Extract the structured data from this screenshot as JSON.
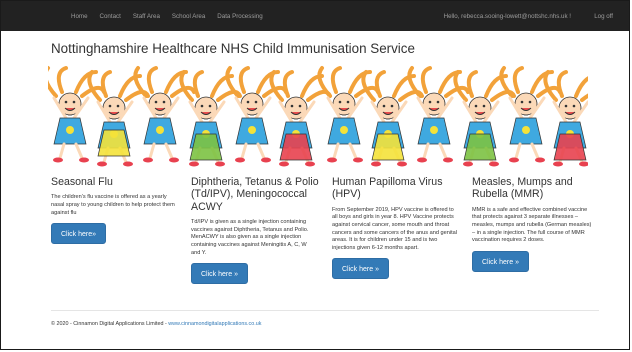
{
  "nav": {
    "items": [
      "Home",
      "Contact",
      "Staff Area",
      "School Area",
      "Data Processing"
    ],
    "user_greeting": "Hello, rebecca.sooing-lowett@nottshc.nhs.uk !",
    "logoff": "Log off"
  },
  "page": {
    "title": "Nottinghamshire Healthcare NHS Child Immunisation Service"
  },
  "columns": [
    {
      "heading": "Seasonal Flu",
      "body": "The children's flu vaccine is offered as a yearly nasal spray to young children to help protect them against flu",
      "button": "Click here»"
    },
    {
      "heading": "Diphtheria, Tetanus & Polio (Td/IPV), Meningococcal ACWY",
      "body": "Td/IPV is given as a single injection containing vaccines against Diphtheria, Tetanus and Polio. MenACWY is also given as a single injection containing vaccines against Meningitis A, C, W and Y.",
      "button": "Click here »"
    },
    {
      "heading": "Human Papilloma Virus (HPV)",
      "body": "From September 2019, HPV vaccine is offered to all boys and girls in year 8. HPV Vaccine protects against cervical cancer, some mouth and throat cancers and some cancers of the anus and genital areas. It is for children under 15 and is two injections given 6-12 months apart.",
      "button": "Click here »"
    },
    {
      "heading": "Measles, Mumps and Rubella (MMR)",
      "body": "MMR is a safe and effective combined vaccine that protects against 3 separate illnesses – measles, mumps and rubella (German measles) – in a single injection. The full course of MMR vaccination requires 2 doses.",
      "button": "Click here »"
    }
  ],
  "footer": {
    "text": "© 2020 - Cinnamon Digital Applications Limited - ",
    "link": "www.cinnamondigitalapplications.co.uk"
  },
  "colors": {
    "navbar": "#222222",
    "button": "#337ab7",
    "link": "#337ab7"
  }
}
